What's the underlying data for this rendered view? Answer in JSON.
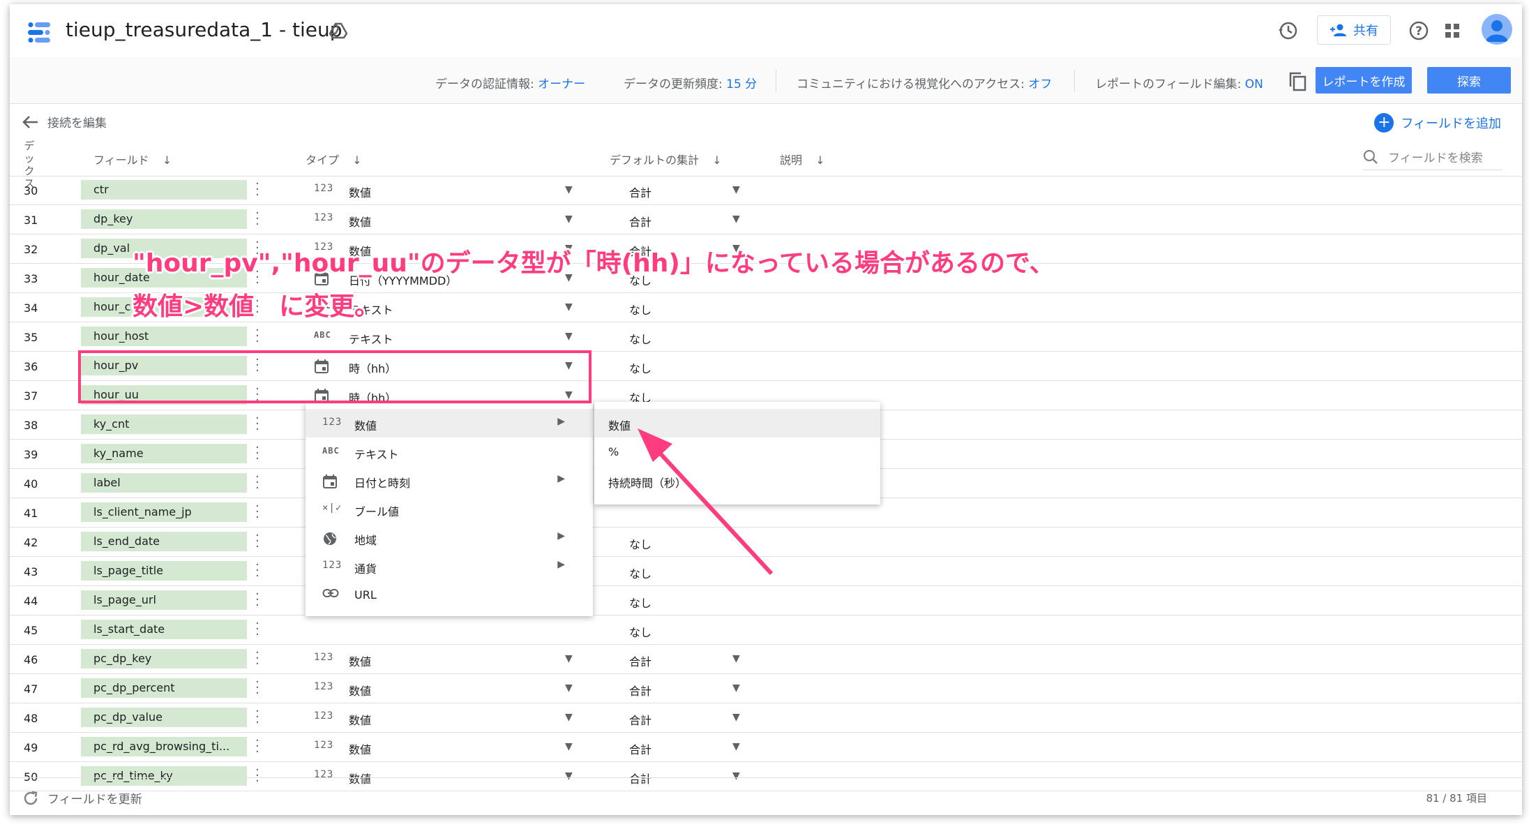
{
  "header": {
    "title": "tieup_treasuredata_1 - tieup",
    "share_label": "共有"
  },
  "subheader": {
    "cred_label": "データの認証情報:",
    "cred_value": "オーナー",
    "freq_label": "データの更新頻度:",
    "freq_value": "15 分",
    "access_label": "コミュニティにおける視覚化へのアクセス:",
    "access_value": "オフ",
    "edit_label": "レポートのフィールド編集:",
    "edit_value": "ON",
    "create_report": "レポートを作成",
    "explore": "探索"
  },
  "toolbar": {
    "back_label": "接続を編集",
    "add_field": "フィールドを追加"
  },
  "columns": {
    "index": "デックス",
    "field": "フィールド",
    "type": "タイプ",
    "agg": "デフォルトの集計",
    "desc": "説明",
    "search_placeholder": "フィールドを検索"
  },
  "rows": [
    {
      "n": "30",
      "field": "ctr",
      "ti": "123",
      "type": "数値",
      "agg": "合計"
    },
    {
      "n": "31",
      "field": "dp_key",
      "ti": "123",
      "type": "数値",
      "agg": "合計"
    },
    {
      "n": "32",
      "field": "dp_val",
      "ti": "123",
      "type": "数値",
      "agg": "合計"
    },
    {
      "n": "33",
      "field": "hour_date",
      "ti": "cal",
      "type": "日付（YYYYMMDD）",
      "agg": "なし"
    },
    {
      "n": "34",
      "field": "hour_c",
      "ti": "ABC",
      "type": "テキスト",
      "agg": "なし"
    },
    {
      "n": "35",
      "field": "hour_host",
      "ti": "ABC",
      "type": "テキスト",
      "agg": "なし"
    },
    {
      "n": "36",
      "field": "hour_pv",
      "ti": "cal",
      "type": "時（hh）",
      "agg": "なし"
    },
    {
      "n": "37",
      "field": "hour_uu",
      "ti": "cal",
      "type": "時（hh）",
      "agg": "なし"
    },
    {
      "n": "38",
      "field": "ky_cnt",
      "ti": "",
      "type": "",
      "agg": ""
    },
    {
      "n": "39",
      "field": "ky_name",
      "ti": "",
      "type": "",
      "agg": ""
    },
    {
      "n": "40",
      "field": "label",
      "ti": "",
      "type": "",
      "agg": ""
    },
    {
      "n": "41",
      "field": "ls_client_name_jp",
      "ti": "",
      "type": "",
      "agg": ""
    },
    {
      "n": "42",
      "field": "ls_end_date",
      "ti": "",
      "type": "",
      "agg": "なし"
    },
    {
      "n": "43",
      "field": "ls_page_title",
      "ti": "",
      "type": "",
      "agg": "なし"
    },
    {
      "n": "44",
      "field": "ls_page_url",
      "ti": "",
      "type": "",
      "agg": "なし"
    },
    {
      "n": "45",
      "field": "ls_start_date",
      "ti": "",
      "type": "",
      "agg": "なし"
    },
    {
      "n": "46",
      "field": "pc_dp_key",
      "ti": "123",
      "type": "数値",
      "agg": "合計"
    },
    {
      "n": "47",
      "field": "pc_dp_percent",
      "ti": "123",
      "type": "数値",
      "agg": "合計"
    },
    {
      "n": "48",
      "field": "pc_dp_value",
      "ti": "123",
      "type": "数値",
      "agg": "合計"
    },
    {
      "n": "49",
      "field": "pc_rd_avg_browsing_ti...",
      "ti": "123",
      "type": "数値",
      "agg": "合計"
    },
    {
      "n": "50",
      "field": "pc_rd_time_ky",
      "ti": "123",
      "type": "数値",
      "agg": "合計"
    }
  ],
  "type_menu": [
    {
      "icon": "123",
      "label": "数値",
      "sub": true
    },
    {
      "icon": "ABC",
      "label": "テキスト",
      "sub": false
    },
    {
      "icon": "cal",
      "label": "日付と時刻",
      "sub": true
    },
    {
      "icon": "bool",
      "label": "ブール値",
      "sub": false
    },
    {
      "icon": "globe",
      "label": "地域",
      "sub": true
    },
    {
      "icon": "123",
      "label": "通貨",
      "sub": true
    },
    {
      "icon": "link",
      "label": "URL",
      "sub": false
    }
  ],
  "sub_menu": [
    "数値",
    "%",
    "持続時間（秒）"
  ],
  "annotation": {
    "line1": "\"hour_pv\",\"hour_uu\"のデータ型が「時(hh)」になっている場合があるので、",
    "line2": "数値>数値　に変更。"
  },
  "footer": {
    "refresh": "フィールドを更新",
    "count": "81 / 81 項目"
  },
  "colors": {
    "accent": "#1a73e8",
    "field_bg": "#d4e8d2",
    "annotation": "#ff3c7f"
  }
}
